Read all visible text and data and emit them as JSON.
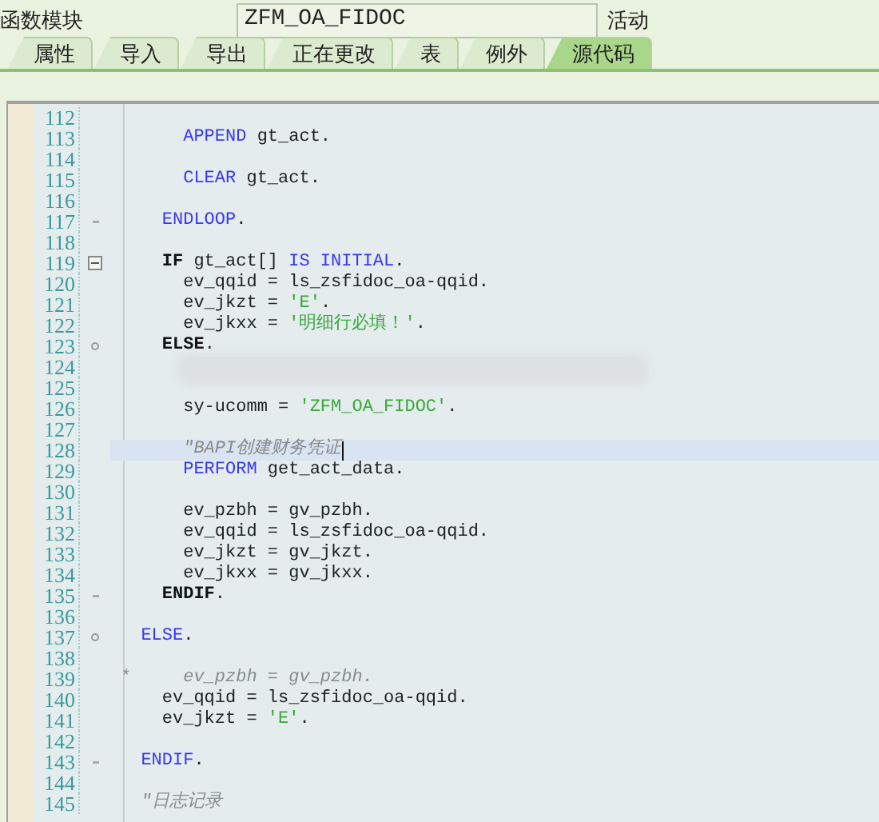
{
  "header": {
    "label": "函数模块",
    "value": "ZFM_OA_FIDOC",
    "status": "活动"
  },
  "tabs": [
    {
      "label": "属性",
      "selected": false
    },
    {
      "label": "导入",
      "selected": false
    },
    {
      "label": "导出",
      "selected": false
    },
    {
      "label": "正在更改",
      "selected": false
    },
    {
      "label": "表",
      "selected": false
    },
    {
      "label": "例外",
      "selected": false
    },
    {
      "label": "源代码",
      "selected": true
    }
  ],
  "editor": {
    "lines": [
      {
        "number": "112",
        "current": false,
        "redacted": false
      },
      {
        "number": "113",
        "current": false,
        "redacted": false,
        "tokens": [
          {
            "kind": "keyword",
            "text": "      APPEND"
          },
          {
            "kind": "plain",
            "text": " gt_act."
          }
        ]
      },
      {
        "number": "114",
        "current": false,
        "redacted": false
      },
      {
        "number": "115",
        "current": false,
        "redacted": false,
        "tokens": [
          {
            "kind": "keyword",
            "text": "      CLEAR"
          },
          {
            "kind": "plain",
            "text": " gt_act."
          }
        ]
      },
      {
        "number": "116",
        "current": false,
        "redacted": false
      },
      {
        "number": "117",
        "marker": {
          "kind": "end"
        },
        "current": false,
        "redacted": false,
        "tokens": [
          {
            "kind": "keyword",
            "text": "    ENDLOOP"
          },
          {
            "kind": "plain",
            "text": "."
          }
        ]
      },
      {
        "number": "118",
        "current": false,
        "redacted": false
      },
      {
        "number": "119",
        "marker": {
          "kind": "collapse"
        },
        "current": false,
        "redacted": false,
        "tokens": [
          {
            "kind": "bold",
            "text": "    IF"
          },
          {
            "kind": "plain",
            "text": " gt_act[] "
          },
          {
            "kind": "keyword",
            "text": "IS INITIAL"
          },
          {
            "kind": "plain",
            "text": "."
          }
        ]
      },
      {
        "number": "120",
        "current": false,
        "redacted": false,
        "tokens": [
          {
            "kind": "plain",
            "text": "      ev_qqid = ls_zsfidoc_oa-qqid."
          }
        ]
      },
      {
        "number": "121",
        "current": false,
        "redacted": false,
        "tokens": [
          {
            "kind": "plain",
            "text": "      ev_jkzt = "
          },
          {
            "kind": "string",
            "text": "'E'"
          },
          {
            "kind": "plain",
            "text": "."
          }
        ]
      },
      {
        "number": "122",
        "current": false,
        "redacted": false,
        "tokens": [
          {
            "kind": "plain",
            "text": "      ev_jkxx = "
          },
          {
            "kind": "string",
            "text": "'明细行必填！'"
          },
          {
            "kind": "plain",
            "text": "."
          }
        ]
      },
      {
        "number": "123",
        "marker": {
          "kind": "branch"
        },
        "current": false,
        "redacted": false,
        "tokens": [
          {
            "kind": "bold",
            "text": "    ELSE"
          },
          {
            "kind": "plain",
            "text": "."
          }
        ]
      },
      {
        "number": "124",
        "current": false,
        "redacted": true
      },
      {
        "number": "125",
        "current": false,
        "redacted": false
      },
      {
        "number": "126",
        "current": false,
        "redacted": false,
        "tokens": [
          {
            "kind": "plain",
            "text": "      sy-ucomm = "
          },
          {
            "kind": "string",
            "text": "'ZFM_OA_FIDOC'"
          },
          {
            "kind": "plain",
            "text": "."
          }
        ]
      },
      {
        "number": "127",
        "current": false,
        "redacted": false
      },
      {
        "number": "128",
        "current": true,
        "redacted": false,
        "tokens": [
          {
            "kind": "comment",
            "text": "      \"BAPI创建财务凭证"
          }
        ]
      },
      {
        "number": "129",
        "current": false,
        "redacted": false,
        "tokens": [
          {
            "kind": "keyword",
            "text": "      PERFORM"
          },
          {
            "kind": "plain",
            "text": " get_act_data."
          }
        ]
      },
      {
        "number": "130",
        "current": false,
        "redacted": false
      },
      {
        "number": "131",
        "current": false,
        "redacted": false,
        "tokens": [
          {
            "kind": "plain",
            "text": "      ev_pzbh = gv_pzbh."
          }
        ]
      },
      {
        "number": "132",
        "current": false,
        "redacted": false,
        "tokens": [
          {
            "kind": "plain",
            "text": "      ev_qqid = ls_zsfidoc_oa-qqid."
          }
        ]
      },
      {
        "number": "133",
        "current": false,
        "redacted": false,
        "tokens": [
          {
            "kind": "plain",
            "text": "      ev_jkzt = gv_jkzt."
          }
        ]
      },
      {
        "number": "134",
        "current": false,
        "redacted": false,
        "tokens": [
          {
            "kind": "plain",
            "text": "      ev_jkxx = gv_jkxx."
          }
        ]
      },
      {
        "number": "135",
        "marker": {
          "kind": "end"
        },
        "current": false,
        "redacted": false,
        "tokens": [
          {
            "kind": "bold",
            "text": "    ENDIF"
          },
          {
            "kind": "plain",
            "text": "."
          }
        ]
      },
      {
        "number": "136",
        "current": false,
        "redacted": false
      },
      {
        "number": "137",
        "marker": {
          "kind": "branch"
        },
        "current": false,
        "redacted": false,
        "tokens": [
          {
            "kind": "keyword",
            "text": "  ELSE"
          },
          {
            "kind": "plain",
            "text": "."
          }
        ]
      },
      {
        "number": "138",
        "current": false,
        "redacted": false
      },
      {
        "number": "139",
        "current": false,
        "redacted": false,
        "tokens": [
          {
            "kind": "comment",
            "text": "*     ev_pzbh = gv_pzbh."
          }
        ]
      },
      {
        "number": "140",
        "current": false,
        "redacted": false,
        "tokens": [
          {
            "kind": "plain",
            "text": "    ev_qqid = ls_zsfidoc_oa-qqid."
          }
        ]
      },
      {
        "number": "141",
        "current": false,
        "redacted": false,
        "tokens": [
          {
            "kind": "plain",
            "text": "    ev_jkzt = "
          },
          {
            "kind": "string",
            "text": "'E'"
          },
          {
            "kind": "plain",
            "text": "."
          }
        ]
      },
      {
        "number": "142",
        "current": false,
        "redacted": false
      },
      {
        "number": "143",
        "marker": {
          "kind": "end"
        },
        "current": false,
        "redacted": false,
        "tokens": [
          {
            "kind": "keyword",
            "text": "  ENDIF"
          },
          {
            "kind": "plain",
            "text": "."
          }
        ]
      },
      {
        "number": "144",
        "current": false,
        "redacted": false
      },
      {
        "number": "145",
        "current": false,
        "redacted": false,
        "tokens": [
          {
            "kind": "comment",
            "text": "  \"日志记录"
          }
        ]
      }
    ]
  }
}
